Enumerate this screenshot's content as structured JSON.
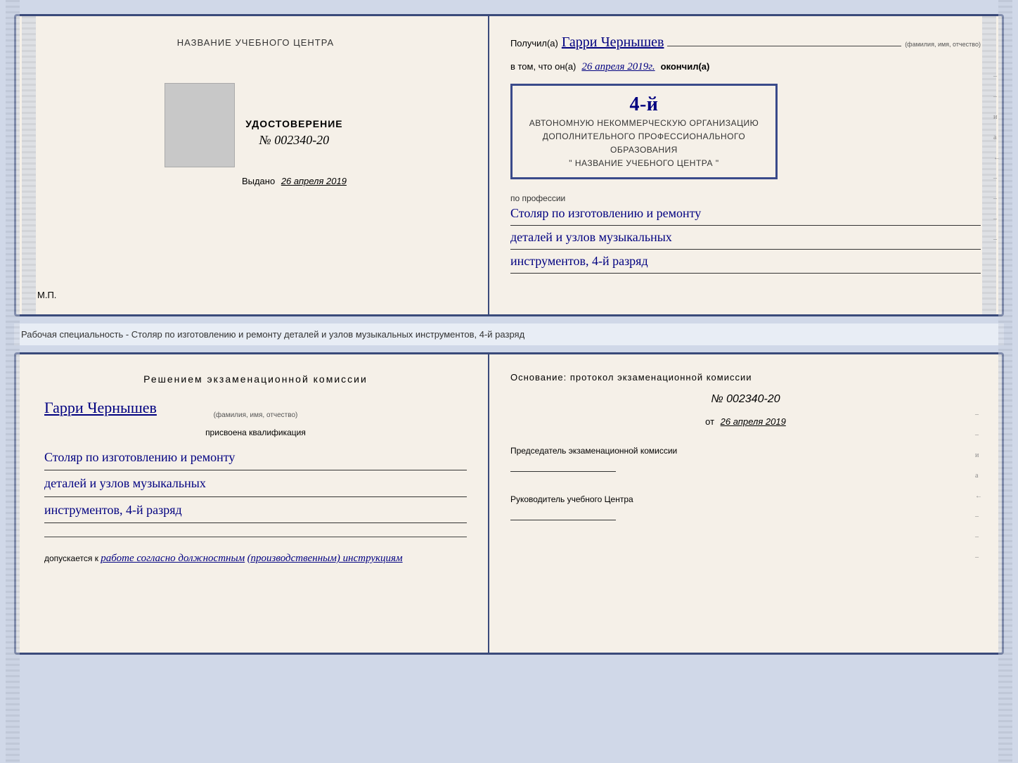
{
  "top_doc": {
    "left": {
      "title": "НАЗВАНИЕ УЧЕБНОГО ЦЕНТРА",
      "photo_alt": "фото",
      "udost_title": "УДОСТОВЕРЕНИЕ",
      "udost_number": "№ 002340-20",
      "vydano_label": "Выдано",
      "vydano_date": "26 апреля 2019",
      "mp_label": "М.П."
    },
    "right": {
      "poluchil_prefix": "Получил(а)",
      "recipient_name": "Гарри Чернышев",
      "fio_note": "(фамилия, имя, отчество)",
      "vtom_prefix": "в том, что он(а)",
      "vtom_date": "26 апреля 2019г.",
      "okoncil": "окончил(а)",
      "stamp_line1": "АВТОНОМНУЮ НЕКОММЕРЧЕСКУЮ ОРГАНИЗАЦИЮ",
      "stamp_line2": "ДОПОЛНИТЕЛЬНОГО ПРОФЕССИОНАЛЬНОГО ОБРАЗОВАНИЯ",
      "stamp_line3": "\" НАЗВАНИЕ УЧЕБНОГО ЦЕНТРА \"",
      "stamp_number": "4-й",
      "po_professii": "по профессии",
      "profession_line1": "Столяр по изготовлению и ремонту",
      "profession_line2": "деталей и узлов музыкальных",
      "profession_line3": "инструментов, 4-й разряд"
    }
  },
  "separator": {
    "text": "Рабочая специальность - Столяр по изготовлению и ремонту деталей и узлов музыкальных инструментов, 4-й разряд"
  },
  "bottom_doc": {
    "left": {
      "heading": "Решением  экзаменационной  комиссии",
      "name_hw": "Гарри Чернышев",
      "fio_note": "(фамилия, имя, отчество)",
      "prisvoena": "присвоена квалификация",
      "qual_line1": "Столяр по изготовлению и ремонту",
      "qual_line2": "деталей и узлов музыкальных",
      "qual_line3": "инструментов, 4-й разряд",
      "dopusk_prefix": "допускается к",
      "dopusk_text": "работе согласно должностным (производственным) инструкциям"
    },
    "right": {
      "osnovanie": "Основание: протокол экзаменационной  комиссии",
      "number": "№  002340-20",
      "ot_label": "от",
      "ot_date": "26 апреля 2019",
      "chairman_title": "Председатель экзаменационной комиссии",
      "director_title": "Руководитель учебного Центра",
      "right_marks": [
        "и",
        "а",
        "←",
        "–",
        "–",
        "–",
        "–"
      ]
    }
  }
}
